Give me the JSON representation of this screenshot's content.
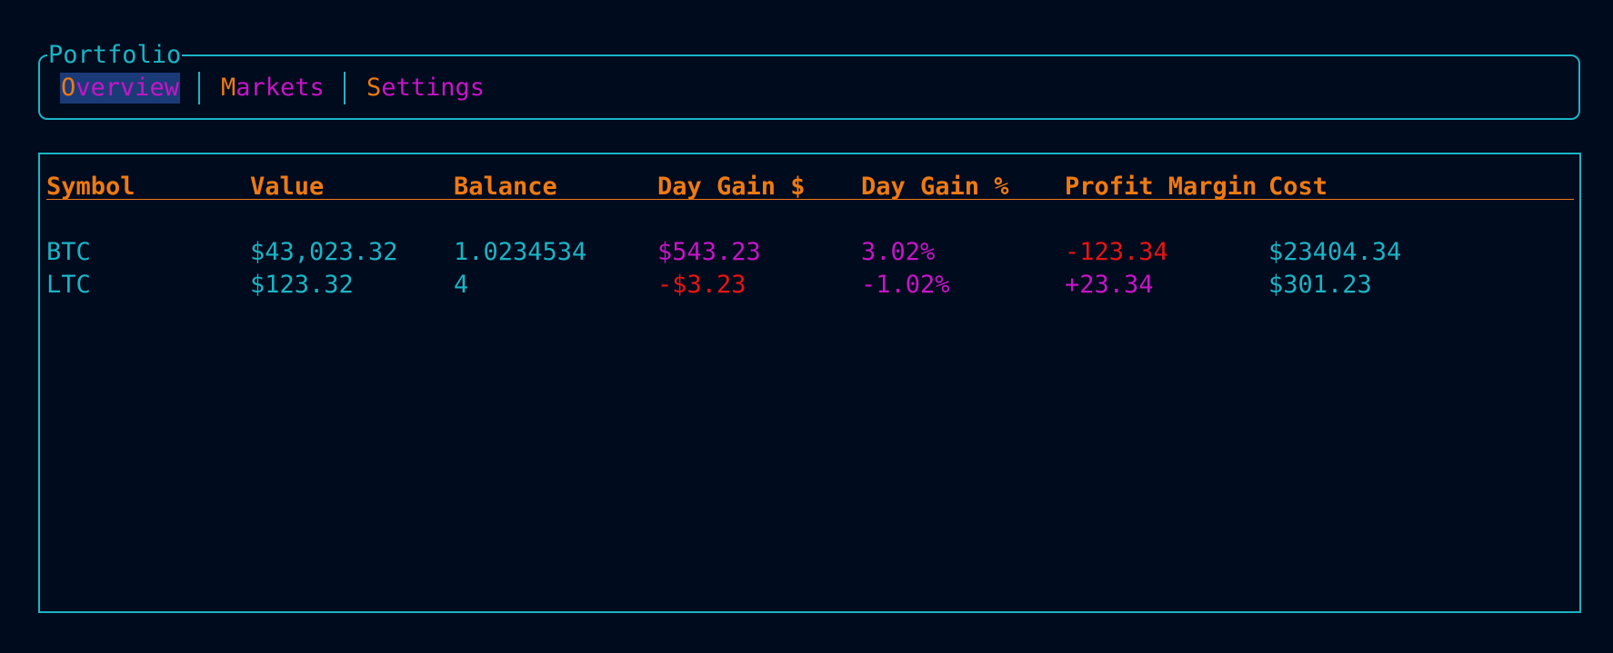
{
  "panel": {
    "title": "Portfolio"
  },
  "tabs": [
    {
      "first": "O",
      "rest": "verview",
      "active": true
    },
    {
      "first": "M",
      "rest": "arkets",
      "active": false
    },
    {
      "first": "S",
      "rest": "ettings",
      "active": false
    }
  ],
  "table": {
    "headers": [
      "Symbol",
      "Value",
      "Balance",
      "Day Gain $",
      "Day Gain %",
      "Profit Margin",
      "Cost"
    ],
    "rows": [
      [
        "BTC",
        "$43,023.32",
        "1.0234534",
        "$543.23",
        "3.02%",
        "-123.34",
        "$23404.34"
      ],
      [
        "LTC",
        "$123.32",
        "4",
        "-$3.23",
        "-1.02%",
        "+23.34",
        "$301.23"
      ]
    ]
  },
  "colors": {
    "background": "#000b1e",
    "border": "#19b5c5",
    "header": "#ef7a12",
    "positive": "#c814c8",
    "negative": "#e81414",
    "active_tab_bg": "#1b3a78"
  }
}
